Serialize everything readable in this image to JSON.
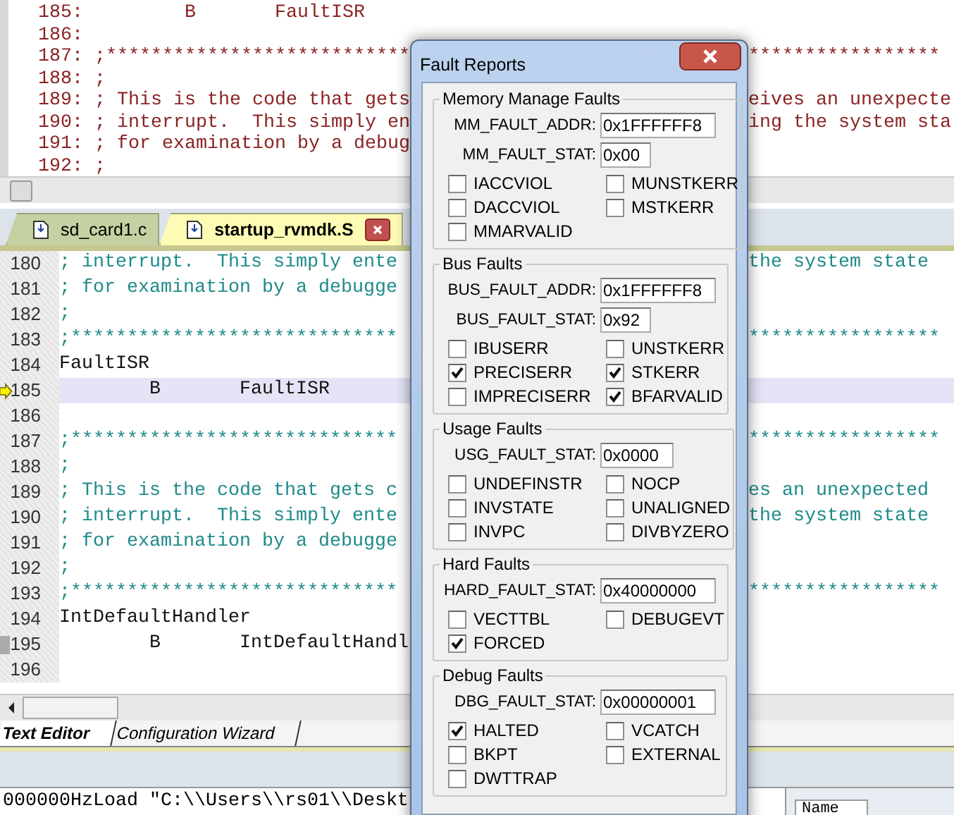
{
  "disassembly": {
    "lines": [
      {
        "number": "185:",
        "code": "        B       FaultISR"
      },
      {
        "number": "186:"
      },
      {
        "number": "187:",
        "code": ";***************************",
        "right": "*****************"
      },
      {
        "number": "188:",
        "code": ";"
      },
      {
        "number": "189:",
        "code": "; This is the code that gets",
        "right": "eives an unexpecte"
      },
      {
        "number": "190:",
        "code": "; interrupt.  This simply en",
        "right": "ing the system sta"
      },
      {
        "number": "191:",
        "code": "; for examination by a debug"
      },
      {
        "number": "192:",
        "code": ";"
      }
    ]
  },
  "file_tabs": [
    {
      "label": "sd_card1.c",
      "selected": false
    },
    {
      "label": "startup_rvmdk.S",
      "selected": true
    }
  ],
  "editor": {
    "lines": [
      {
        "number": "180",
        "code": "; interrupt.  This simply ente",
        "right": "the system state"
      },
      {
        "number": "181",
        "code": "; for examination by a debugge"
      },
      {
        "number": "182",
        "code": ";"
      },
      {
        "number": "183",
        "code": ";*****************************",
        "right": "*****************"
      },
      {
        "number": "184",
        "code": "FaultISR",
        "kind": "label"
      },
      {
        "number": "185",
        "code": "        B       FaultISR",
        "kind": "label",
        "current": true
      },
      {
        "number": "186"
      },
      {
        "number": "187",
        "code": ";*****************************",
        "right": "*****************"
      },
      {
        "number": "188",
        "code": ";"
      },
      {
        "number": "189",
        "code": "; This is the code that gets c",
        "right": "es an unexpected"
      },
      {
        "number": "190",
        "code": "; interrupt.  This simply ente",
        "right": "the system state"
      },
      {
        "number": "191",
        "code": "; for examination by a debugge"
      },
      {
        "number": "192",
        "code": ";"
      },
      {
        "number": "193",
        "code": ";*****************************",
        "right": "*****************"
      },
      {
        "number": "194",
        "code": "IntDefaultHandler",
        "kind": "label"
      },
      {
        "number": "195",
        "code": "        B       IntDefaultHandl",
        "kind": "label",
        "marked": true
      },
      {
        "number": "196"
      }
    ]
  },
  "editor_tabs": [
    {
      "label": "Text Editor",
      "selected": true
    },
    {
      "label": "Configuration Wizard",
      "selected": false
    }
  ],
  "command_output": "000000HzLoad \"C:\\\\Users\\\\rs01\\\\Deskt",
  "locals": {
    "column": "Name"
  },
  "dialog": {
    "title": "Fault Reports",
    "groups": [
      {
        "title": "Memory Manage Faults",
        "fields": [
          {
            "label": "MM_FAULT_ADDR:",
            "value": "0x1FFFFFF8"
          },
          {
            "label": "MM_FAULT_STAT:",
            "value": "0x00"
          }
        ],
        "flags": [
          {
            "label": "IACCVIOL",
            "checked": false
          },
          {
            "label": "MUNSTKERR",
            "checked": false
          },
          {
            "label": "DACCVIOL",
            "checked": false
          },
          {
            "label": "MSTKERR",
            "checked": false
          },
          {
            "label": "MMARVALID",
            "checked": false
          }
        ]
      },
      {
        "title": "Bus Faults",
        "fields": [
          {
            "label": "BUS_FAULT_ADDR:",
            "value": "0x1FFFFFF8"
          },
          {
            "label": "BUS_FAULT_STAT:",
            "value": "0x92"
          }
        ],
        "flags": [
          {
            "label": "IBUSERR",
            "checked": false
          },
          {
            "label": "UNSTKERR",
            "checked": false
          },
          {
            "label": "PRECISERR",
            "checked": true
          },
          {
            "label": "STKERR",
            "checked": true
          },
          {
            "label": "IMPRECISERR",
            "checked": false
          },
          {
            "label": "BFARVALID",
            "checked": true
          }
        ]
      },
      {
        "title": "Usage Faults",
        "fields": [
          {
            "label": "USG_FAULT_STAT:",
            "value": "0x0000"
          }
        ],
        "flags": [
          {
            "label": "UNDEFINSTR",
            "checked": false
          },
          {
            "label": "NOCP",
            "checked": false
          },
          {
            "label": "INVSTATE",
            "checked": false
          },
          {
            "label": "UNALIGNED",
            "checked": false
          },
          {
            "label": "INVPC",
            "checked": false
          },
          {
            "label": "DIVBYZERO",
            "checked": false
          }
        ]
      },
      {
        "title": "Hard Faults",
        "fields": [
          {
            "label": "HARD_FAULT_STAT:",
            "value": "0x40000000"
          }
        ],
        "flags": [
          {
            "label": "VECTTBL",
            "checked": false
          },
          {
            "label": "DEBUGEVT",
            "checked": false
          },
          {
            "label": "FORCED",
            "checked": true
          }
        ]
      },
      {
        "title": "Debug Faults",
        "fields": [
          {
            "label": "DBG_FAULT_STAT:",
            "value": "0x00000001"
          }
        ],
        "flags": [
          {
            "label": "HALTED",
            "checked": true
          },
          {
            "label": "VCATCH",
            "checked": false
          },
          {
            "label": "BKPT",
            "checked": false
          },
          {
            "label": "EXTERNAL",
            "checked": false
          },
          {
            "label": "DWTTRAP",
            "checked": false
          }
        ]
      }
    ]
  }
}
